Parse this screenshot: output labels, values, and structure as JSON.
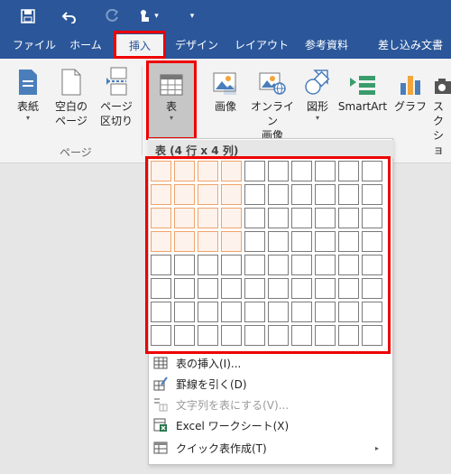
{
  "quick_access": {
    "icons": [
      "save-icon",
      "undo-icon",
      "redo-icon",
      "touch-mode-icon",
      "customize-qat-icon"
    ],
    "touch_chevron": "▾",
    "customize_chevron": "▾"
  },
  "tabs": [
    {
      "label": "ファイル"
    },
    {
      "label": "ホーム"
    },
    {
      "label": "挿入"
    },
    {
      "label": "デザイン"
    },
    {
      "label": "レイアウト"
    },
    {
      "label": "参考資料"
    },
    {
      "label": "差し込み文書"
    }
  ],
  "ribbon": {
    "pages_group": {
      "label": "ページ",
      "cover": {
        "line1": "表紙",
        "dropdown": "▾"
      },
      "blank": {
        "line1": "空白の",
        "line2": "ページ"
      },
      "break": {
        "line1": "ページ",
        "line2": "区切り"
      }
    },
    "table_button": {
      "label": "表",
      "dropdown": "▾"
    },
    "picture": {
      "label": "画像"
    },
    "online_picture": {
      "line1": "オンライン",
      "line2": "画像"
    },
    "shapes": {
      "label": "図形",
      "dropdown": "▾"
    },
    "smartart": {
      "label": "SmartArt"
    },
    "chart": {
      "label": "グラフ"
    },
    "screenshot": {
      "line1": "スク",
      "line2": "ショ"
    }
  },
  "table_panel": {
    "title": "表 (4 行 x 4 列)",
    "rows": 8,
    "cols": 10,
    "selected_rows": 4,
    "selected_cols": 4,
    "menu": [
      {
        "label": "表の挿入(I)...",
        "icon": "insert-table-icon",
        "disabled": false,
        "submenu": false
      },
      {
        "label": "罫線を引く(D)",
        "icon": "draw-table-icon",
        "disabled": false,
        "submenu": false
      },
      {
        "label": "文字列を表にする(V)...",
        "icon": "convert-text-to-table-icon",
        "disabled": true,
        "submenu": false
      },
      {
        "label": "Excel ワークシート(X)",
        "icon": "excel-worksheet-icon",
        "disabled": false,
        "submenu": false
      },
      {
        "label": "クイック表作成(T)",
        "icon": "quick-tables-icon",
        "disabled": false,
        "submenu": true
      }
    ],
    "submenu_arrow": "▸"
  },
  "colors": {
    "titlebar": "#2b579a",
    "highlight_border": "#e00000",
    "selected_cell": "#f0a36b"
  }
}
